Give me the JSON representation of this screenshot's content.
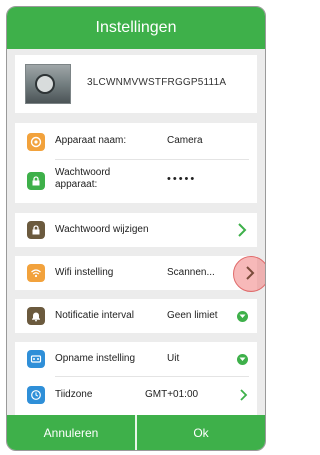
{
  "header": {
    "title": "Instellingen"
  },
  "device": {
    "id": "3LCWNMVWSTFRGGP5111A"
  },
  "account": {
    "name_label": "Apparaat naam:",
    "name_value": "Camera",
    "password_label": "Wachtwoord apparaat:",
    "password_value": "•••••"
  },
  "settings": {
    "change_password": "Wachtwoord wijzigen",
    "wifi_label": "Wifi instelling",
    "wifi_value": "Scannen...",
    "notification_label": "Notificatie interval",
    "notification_value": "Geen limiet",
    "recording_label": "Opname instelling",
    "recording_value": "Uit",
    "timezone_label": "Tiidzone",
    "timezone_value": "GMT+01:00"
  },
  "footer": {
    "cancel": "Annuleren",
    "ok": "Ok"
  },
  "colors": {
    "accent": "#3eb04a",
    "orange": "#f2a23c",
    "brown": "#6b5a3e",
    "blue": "#2f8fd8",
    "highlight": "#f08080"
  }
}
